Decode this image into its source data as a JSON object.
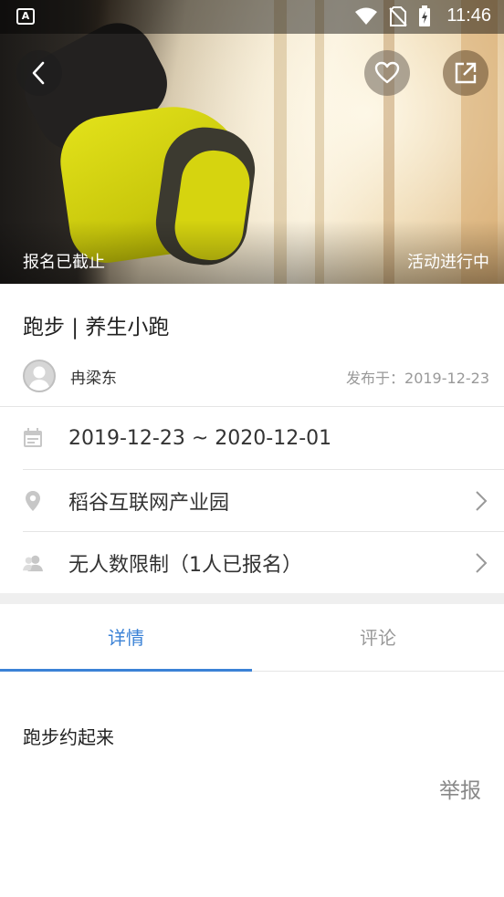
{
  "statusbar": {
    "time": "11:46",
    "app_icon": "A"
  },
  "hero": {
    "left_label": "报名已截止",
    "right_label": "活动进行中",
    "icons": {
      "back": "chevron-left-icon",
      "favorite": "heart-icon",
      "share": "external-link-icon"
    }
  },
  "event": {
    "title": "跑步 | 养生小跑",
    "author": "冉梁东",
    "published_prefix": "发布于：",
    "published_date": "2019-12-23"
  },
  "details": {
    "date_range": "2019-12-23 ~ 2020-12-01",
    "location": "稻谷互联网产业园",
    "participants": "无人数限制（1人已报名）"
  },
  "tabs": [
    {
      "label": "详情",
      "active": true
    },
    {
      "label": "评论",
      "active": false
    }
  ],
  "content": {
    "description": "跑步约起来"
  },
  "actions": {
    "report": "举报"
  },
  "colors": {
    "accent": "#3b82d6"
  }
}
